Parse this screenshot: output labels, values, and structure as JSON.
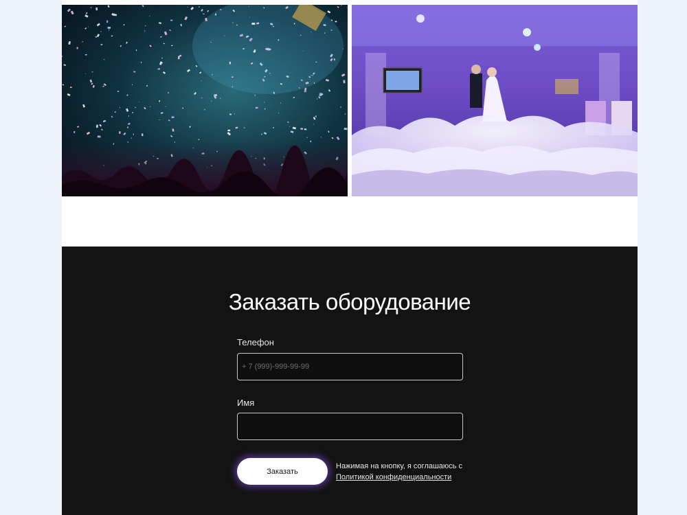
{
  "gallery": {
    "images": [
      {
        "name": "concert-confetti-photo"
      },
      {
        "name": "wedding-heavy-smoke-photo"
      }
    ]
  },
  "order_form": {
    "title": "Заказать оборудование",
    "phone": {
      "label": "Телефон",
      "placeholder": "+ 7 (999)-999-99-99",
      "value": ""
    },
    "name": {
      "label": "Имя",
      "placeholder": "",
      "value": ""
    },
    "submit_label": "Заказать",
    "consent_text": "Нажимая на кнопку, я соглашаюсь с",
    "privacy_link_text": "Политикой конфиденциальности"
  },
  "colors": {
    "page_background": "#eef2fb",
    "section_background": "#131314",
    "button_background": "#ffffff",
    "button_glow": "#9650ff"
  }
}
